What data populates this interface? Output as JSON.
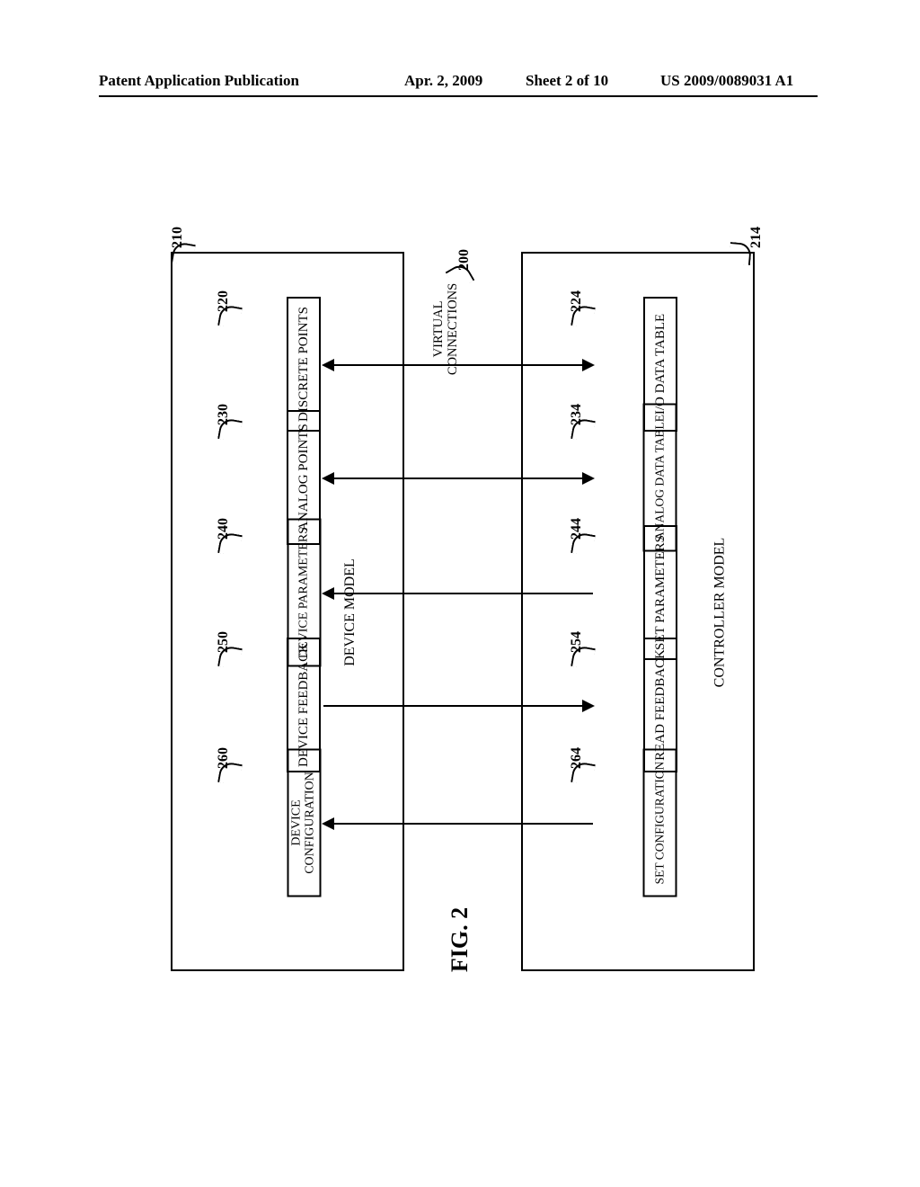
{
  "header": {
    "left": "Patent Application Publication",
    "date": "Apr. 2, 2009",
    "sheet": "Sheet 2 of 10",
    "pubno": "US 2009/0089031 A1"
  },
  "caption": "FIG. 2",
  "virtual_connections": "VIRTUAL\nCONNECTIONS",
  "device_model": {
    "title": "DEVICE MODEL",
    "ref": "210",
    "items": [
      {
        "ref": "220",
        "label": "DISCRETE POINTS"
      },
      {
        "ref": "230",
        "label": "ANALOG POINTS"
      },
      {
        "ref": "240",
        "label": "DEVICE PARAMETERS"
      },
      {
        "ref": "250",
        "label": "DEVICE FEEDBACK"
      },
      {
        "ref": "260",
        "label": "DEVICE CONFIGURATION"
      }
    ]
  },
  "controller_model": {
    "title": "CONTROLLER MODEL",
    "ref": "214",
    "items": [
      {
        "ref": "224",
        "label": "I/O DATA TABLE"
      },
      {
        "ref": "234",
        "label": "ANALOG DATA TABLE"
      },
      {
        "ref": "244",
        "label": "SET PARAMETERS"
      },
      {
        "ref": "254",
        "label": "READ FEEDBACK"
      },
      {
        "ref": "264",
        "label": "SET CONFIGURATION"
      }
    ]
  },
  "virtual_connections_ref": "200",
  "connections": [
    {
      "from": "220",
      "to": "224",
      "direction": "both"
    },
    {
      "from": "230",
      "to": "234",
      "direction": "both"
    },
    {
      "from": "244",
      "to": "240",
      "direction": "to_device"
    },
    {
      "from": "250",
      "to": "254",
      "direction": "to_controller"
    },
    {
      "from": "264",
      "to": "260",
      "direction": "to_device"
    }
  ]
}
